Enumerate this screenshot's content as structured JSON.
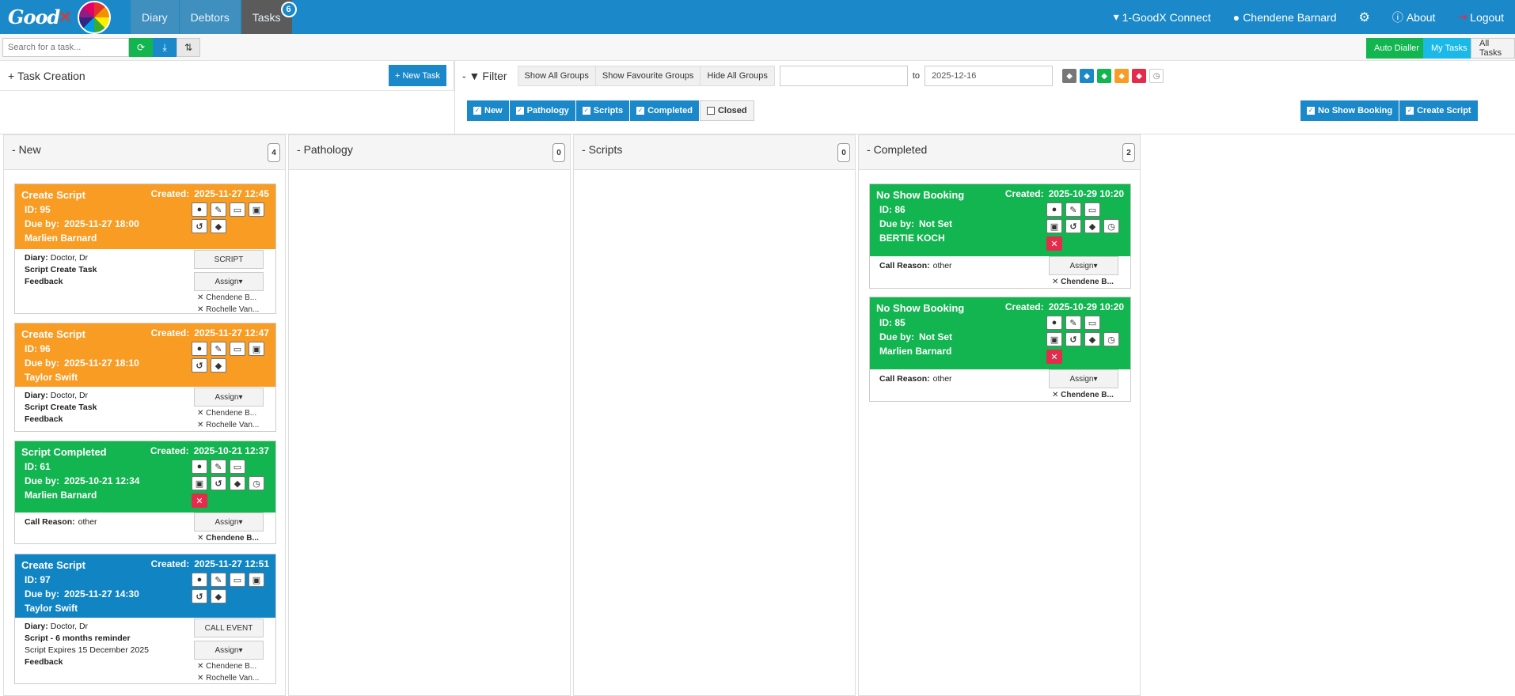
{
  "app": {
    "logo": "Good"
  },
  "nav": {
    "diary": "Diary",
    "debtors": "Debtors",
    "tasks": "Tasks",
    "tasks_badge": "6",
    "connect": "1-GoodX Connect",
    "user": "Chendene Barnard",
    "about": "About",
    "logout": "Logout"
  },
  "toolbar": {
    "search_placeholder": "Search for a task...",
    "auto_dialler": "Auto Dialler",
    "my_tasks": "My Tasks",
    "all_tasks": "All Tasks"
  },
  "task_creation": {
    "title": "Task Creation",
    "new_task": "New Task"
  },
  "filter": {
    "title": "Filter",
    "show_all_groups": "Show All Groups",
    "show_fav_groups": "Show Favourite Groups",
    "hide_all_groups": "Hide All Groups",
    "date_from": "",
    "to_label": "to",
    "date_to": "2025-12-16"
  },
  "status_chips": [
    "New",
    "Pathology",
    "Scripts",
    "Completed"
  ],
  "closed_chip": "Closed",
  "type_chips": [
    "No Show Booking",
    "Create Script"
  ],
  "tag_colors": [
    "#777777",
    "#1a88c9",
    "#12b54f",
    "#f89c24",
    "#e52b4c"
  ],
  "columns": [
    {
      "title": "New",
      "count": "4"
    },
    {
      "title": "Pathology",
      "count": "0"
    },
    {
      "title": "Scripts",
      "count": "0"
    },
    {
      "title": "Completed",
      "count": "2"
    }
  ],
  "cards": [
    {
      "title": "Create Script",
      "created_label": "Created:",
      "created": "2025-11-27 12:45",
      "id": "ID: 95",
      "due_label": "Due by:",
      "due": "2025-11-27 18:00",
      "name": "Marlien Barnard",
      "diary_label": "Diary:",
      "diary": "Doctor, Dr",
      "line2": "Script Create Task",
      "line3": "Feedback",
      "action": "SCRIPT",
      "assign": "Assign",
      "assignees": [
        "Chendene B...",
        "Rochelle Van..."
      ]
    },
    {
      "title": "Create Script",
      "created_label": "Created:",
      "created": "2025-11-27 12:47",
      "id": "ID: 96",
      "due_label": "Due by:",
      "due": "2025-11-27 18:10",
      "name": "Taylor Swift",
      "diary_label": "Diary:",
      "diary": "Doctor, Dr",
      "line2": "Script Create Task",
      "line3": "Feedback",
      "assign": "Assign",
      "assignees": [
        "Chendene B...",
        "Rochelle Van..."
      ]
    },
    {
      "title": "Script Completed",
      "created_label": "Created:",
      "created": "2025-10-21 12:37",
      "id": "ID: 61",
      "due_label": "Due by:",
      "due": "2025-10-21 12:34",
      "name": "Marlien Barnard",
      "reason_label": "Call Reason:",
      "reason": "other",
      "assign": "Assign",
      "assignees": [
        "Chendene B..."
      ]
    },
    {
      "title": "Create Script",
      "created_label": "Created:",
      "created": "2025-11-27 12:51",
      "id": "ID: 97",
      "due_label": "Due by:",
      "due": "2025-11-27 14:30",
      "name": "Taylor Swift",
      "diary_label": "Diary:",
      "diary": "Doctor, Dr",
      "line2": "Script - 6 months reminder",
      "line3": "Script Expires 15 December 2025",
      "line4": "Feedback",
      "action": "CALL EVENT",
      "assign": "Assign",
      "assignees": [
        "Chendene B...",
        "Rochelle Van..."
      ]
    },
    {
      "title": "No Show Booking",
      "created_label": "Created:",
      "created": "2025-10-29 10:20",
      "id": "ID: 86",
      "due_label": "Due by:",
      "due": "Not Set",
      "name": "BERTIE KOCH",
      "reason_label": "Call Reason:",
      "reason": "other",
      "assign": "Assign",
      "assignees": [
        "Chendene B..."
      ]
    },
    {
      "title": "No Show Booking",
      "created_label": "Created:",
      "created": "2025-10-29 10:20",
      "id": "ID: 85",
      "due_label": "Due by:",
      "due": "Not Set",
      "name": "Marlien Barnard",
      "reason_label": "Call Reason:",
      "reason": "other",
      "assign": "Assign",
      "assignees": [
        "Chendene B..."
      ]
    }
  ]
}
